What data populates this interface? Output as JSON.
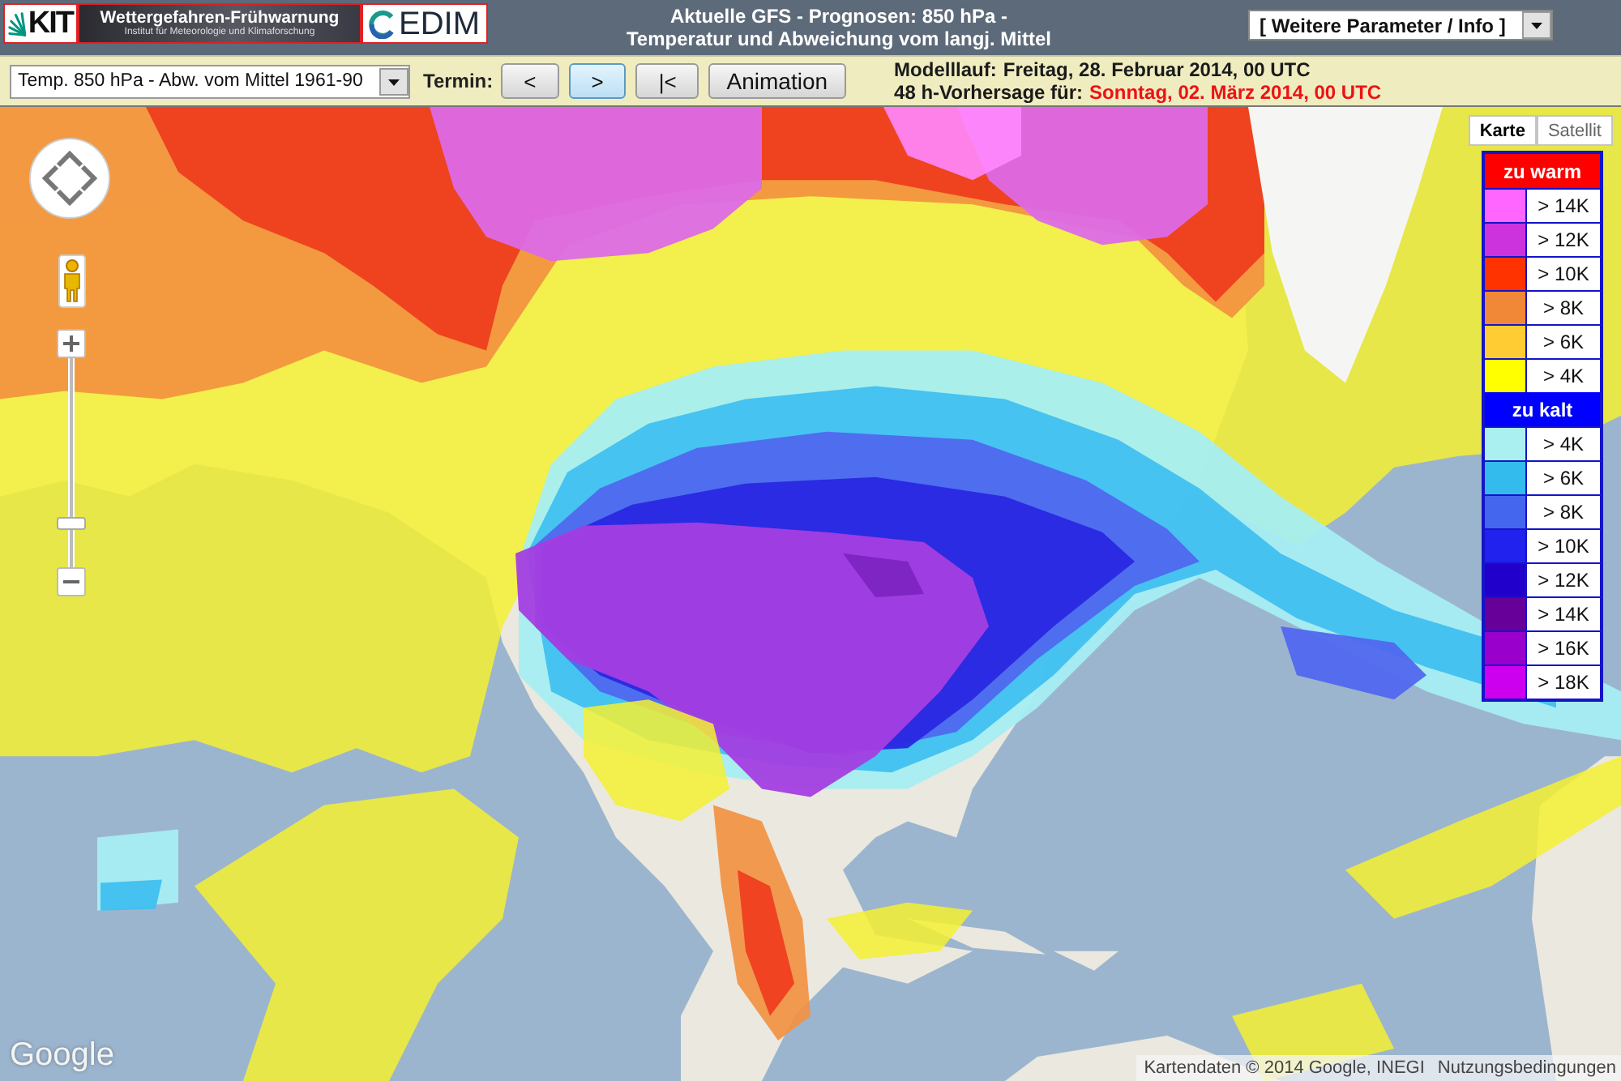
{
  "header": {
    "logos": [
      {
        "kind": "kit",
        "text": "KIT"
      },
      {
        "kind": "banner",
        "title": "Wettergefahren-Frühwarnung",
        "subtitle": "Institut für Meteorologie und Klimaforschung"
      },
      {
        "kind": "cedim",
        "text": "EDIM"
      }
    ],
    "title_lines": [
      "Aktuelle GFS - Prognosen: 850 hPa -",
      "Temperatur und Abweichung vom langj. Mittel"
    ],
    "info_dropdown": {
      "value": "[ Weitere Parameter / Info ]"
    }
  },
  "toolbar": {
    "parameter_dropdown": {
      "value": "Temp. 850 hPa - Abw. vom Mittel 1961-90"
    },
    "termin_label": "Termin:",
    "buttons": [
      {
        "label": "<",
        "selected": false
      },
      {
        "label": ">",
        "selected": true
      },
      {
        "label": "|<",
        "selected": false
      },
      {
        "label": "Animation",
        "selected": false
      }
    ],
    "run_info": [
      {
        "label": "Modelllauf:",
        "value": "Freitag, 28. Februar 2014, 00 UTC",
        "highlighted": false
      },
      {
        "label": "48 h-Vorhersage für:",
        "value": "Sonntag, 02. März 2014, 00 UTC",
        "highlighted": true
      }
    ]
  },
  "map": {
    "map_types": [
      {
        "label": "Karte",
        "selected": true
      },
      {
        "label": "Satellit",
        "selected": false
      }
    ],
    "zoom": {
      "level": 0.19
    },
    "legend": {
      "sections": [
        {
          "title": "zu warm",
          "color": "#ff0000",
          "items": [
            {
              "label": "> 14K",
              "color": "#ff66ff"
            },
            {
              "label": "> 12K",
              "color": "#cc33dd"
            },
            {
              "label": "> 10K",
              "color": "#ff3300"
            },
            {
              "label": "> 8K",
              "color": "#f08838"
            },
            {
              "label": "> 6K",
              "color": "#ffcc33"
            },
            {
              "label": "> 4K",
              "color": "#ffff00"
            }
          ]
        },
        {
          "title": "zu kalt",
          "color": "#0000ff",
          "items": [
            {
              "label": "> 4K",
              "color": "#aaf0f0"
            },
            {
              "label": "> 6K",
              "color": "#33bbee"
            },
            {
              "label": "> 8K",
              "color": "#4466ee"
            },
            {
              "label": "> 10K",
              "color": "#2222ee"
            },
            {
              "label": "> 12K",
              "color": "#2200cc"
            },
            {
              "label": "> 14K",
              "color": "#660099"
            },
            {
              "label": "> 16K",
              "color": "#9900cc"
            },
            {
              "label": "> 18K",
              "color": "#cc00ee"
            }
          ]
        }
      ]
    },
    "logo": "Google",
    "attribution": "Kartendaten © 2014 Google, INEGI",
    "terms_link": "Nutzungsbedingungen"
  }
}
